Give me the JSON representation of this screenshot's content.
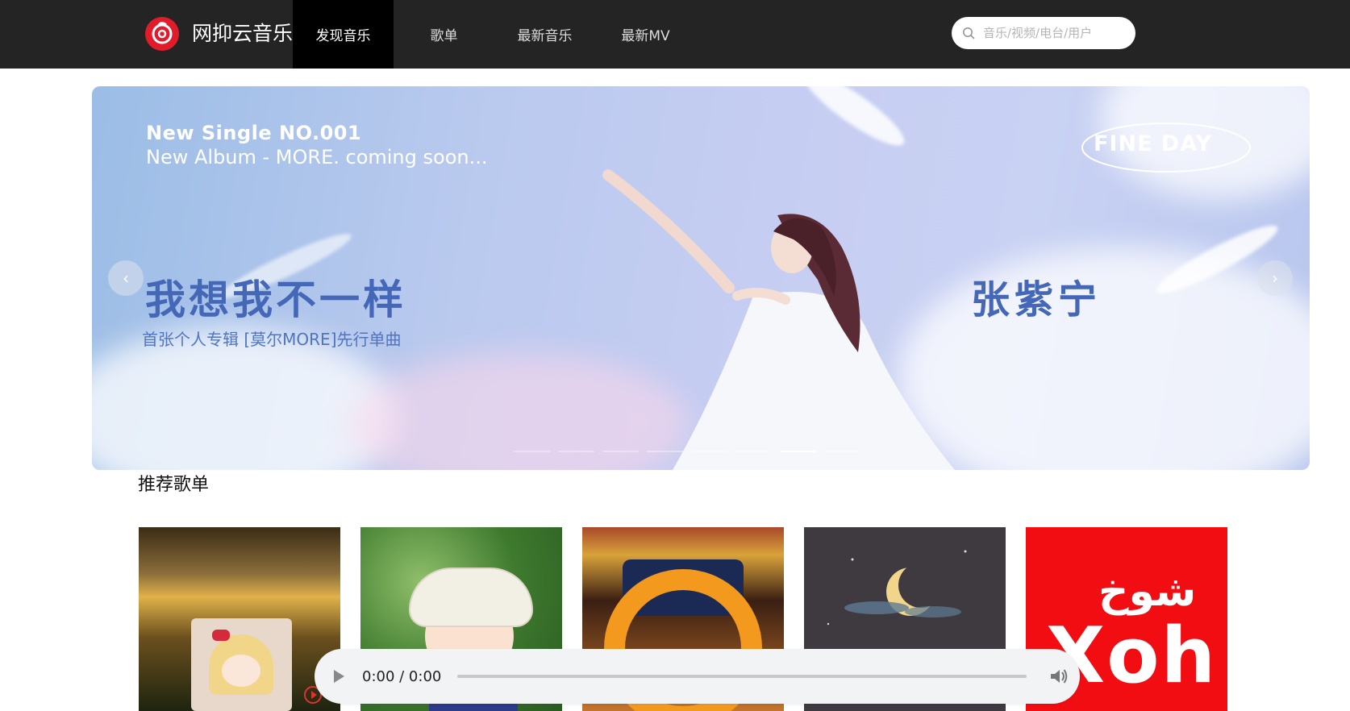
{
  "header": {
    "brand": "网抑云音乐",
    "nav": [
      "发现音乐",
      "歌单",
      "最新音乐",
      "最新MV"
    ],
    "search_placeholder": "音乐/视频/电台/用户"
  },
  "banner": {
    "line1": "New Single NO.001",
    "line2": "New Album - MORE. coming soon...",
    "title": "我想我不一样",
    "subtitle": "首张个人专辑 [莫尔MORE]先行单曲",
    "artist": "张紫宁",
    "logo_text": "FINE DAY",
    "prev_label": "‹",
    "next_label": "›"
  },
  "section": {
    "title": "推荐歌单"
  },
  "covers": [
    {
      "icon": "sunset-anime-girl"
    },
    {
      "icon": "girl-straw-hat"
    },
    {
      "icon": "car-steering-wheel"
    },
    {
      "icon": "crescent-moon-night"
    },
    {
      "icon": "red-arabic-logo",
      "text_top": "شوخ",
      "text_bottom": "Xoh"
    }
  ],
  "player": {
    "time": "0:00 / 0:00"
  },
  "colors": {
    "header_bg": "#242424",
    "active_nav_bg": "#000000",
    "brand_red": "#e21b2b",
    "banner_blue": "#4467b8"
  }
}
